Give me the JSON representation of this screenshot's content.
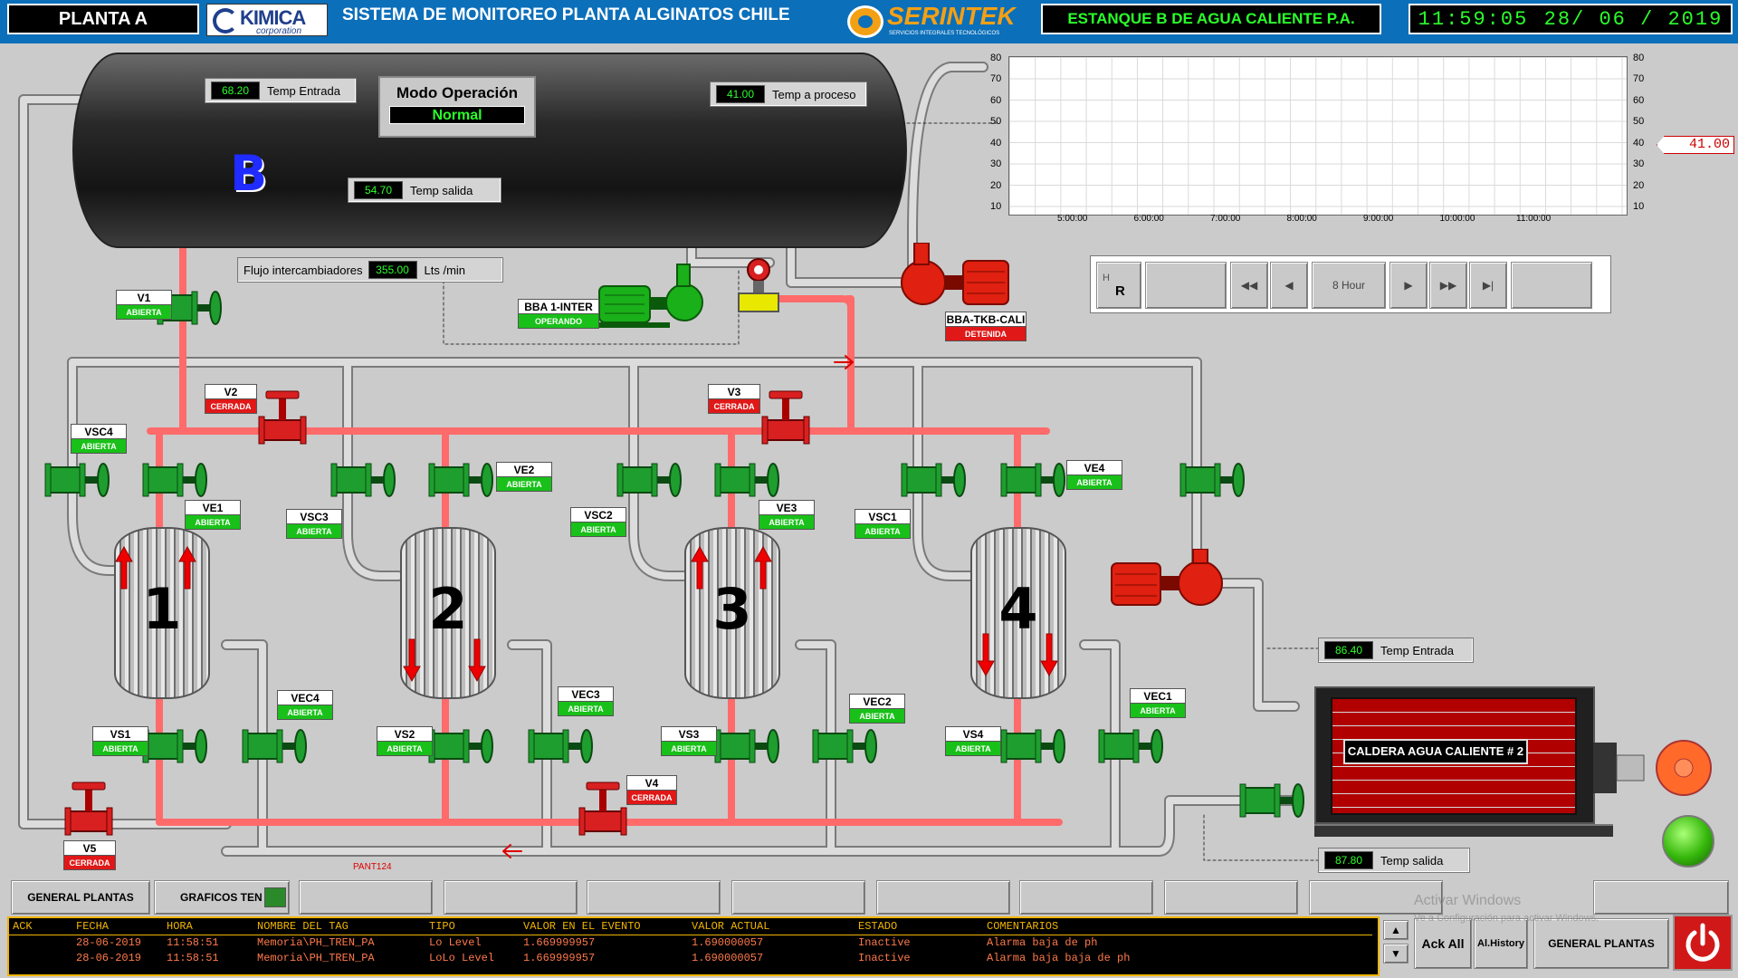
{
  "header": {
    "plant": "PLANTA A",
    "kimica_name": "KIMICA",
    "kimica_sub": "corporation",
    "title": "SISTEMA DE MONITOREO PLANTA ALGINATOS CHILE",
    "serintek_name": "SERINTEK",
    "serintek_sub": "SERVICIOS INTEGRALES TECNOLÓGICOS",
    "tank_name": "ESTANQUE B DE AGUA CALIENTE P.A.",
    "time": "11:59:05",
    "date": "28/ 06 / 2019"
  },
  "tank": {
    "letter": "B",
    "temp_entrada": {
      "value": "68.20",
      "label": "Temp Entrada"
    },
    "temp_salida": {
      "value": "54.70",
      "label": "Temp salida"
    },
    "temp_proceso": {
      "value": "41.00",
      "label": "Temp a proceso"
    },
    "mode_title": "Modo Operación",
    "mode_value": "Normal"
  },
  "flow": {
    "label": "Flujo intercambiadores",
    "value": "355.00",
    "unit": "Lts /min"
  },
  "pumps": {
    "inter": {
      "name": "BBA 1-INTER",
      "status": "OPERANDO"
    },
    "tkb": {
      "name": "BBA-TKB-CALI",
      "status": "DETENIDA"
    }
  },
  "valves": {
    "V1": "ABIERTA",
    "V2": "CERRADA",
    "V3": "CERRADA",
    "V4": "CERRADA",
    "V5": "CERRADA",
    "VSC4": "ABIERTA",
    "VSC3": "ABIERTA",
    "VSC2": "ABIERTA",
    "VSC1": "ABIERTA",
    "VE1": "ABIERTA",
    "VE2": "ABIERTA",
    "VE3": "ABIERTA",
    "VE4": "ABIERTA",
    "VS1": "ABIERTA",
    "VS2": "ABIERTA",
    "VS3": "ABIERTA",
    "VS4": "ABIERTA",
    "VEC4": "ABIERTA",
    "VEC3": "ABIERTA",
    "VEC2": "ABIERTA",
    "VEC1": "ABIERTA"
  },
  "exchangers": [
    "1",
    "2",
    "3",
    "4"
  ],
  "boiler": {
    "name": "CALDERA AGUA CALIENTE # 2",
    "temp_entrada": {
      "value": "86.40",
      "label": "Temp Entrada"
    },
    "temp_salida": {
      "value": "87.80",
      "label": "Temp salida"
    }
  },
  "pipe_tag": "PANT124",
  "chart_data": {
    "type": "line",
    "title": "",
    "ylim": [
      10,
      80
    ],
    "y_ticks": [
      "80",
      "70",
      "60",
      "50",
      "40",
      "30",
      "20",
      "10"
    ],
    "x_ticks": [
      "5:00:00",
      "6:00:00",
      "7:00:00",
      "8:00:00",
      "9:00:00",
      "10:00:00",
      "11:00:00"
    ],
    "current_marker": "41.00",
    "grid": true
  },
  "trend_nav": {
    "h": "H",
    "r": "R",
    "range": "8 Hour"
  },
  "bottom_buttons": {
    "general": "GENERAL PLANTAS",
    "graficos": "GRAFICOS TEN"
  },
  "alarms": {
    "columns": [
      "ACK",
      "FECHA",
      "HORA",
      "NOMBRE DEL TAG",
      "TIPO",
      "VALOR EN EL EVENTO",
      "VALOR ACTUAL",
      "ESTADO",
      "COMENTARIOS"
    ],
    "rows": [
      [
        "",
        "28-06-2019",
        "11:58:51",
        "Memoria\\PH_TREN_PA",
        "Lo Level",
        "1.669999957",
        "1.690000057",
        "Inactive",
        "Alarma baja de ph"
      ],
      [
        "",
        "28-06-2019",
        "11:58:51",
        "Memoria\\PH_TREN_PA",
        "LoLo Level",
        "1.669999957",
        "1.690000057",
        "Inactive",
        "Alarma baja baja de ph"
      ]
    ],
    "ack_all": "Ack All",
    "history": "Al.History",
    "general": "GENERAL PLANTAS"
  },
  "watermark": {
    "title": "Activar Windows",
    "sub": "Ve a Configuración para activar Windows."
  },
  "colors": {
    "pipe_hot": "#ff6b6b",
    "pipe_cold": "#d8d8d8",
    "valve_green": "#1e9e2e",
    "valve_red": "#d82020",
    "header_blue": "#0b6fba"
  }
}
